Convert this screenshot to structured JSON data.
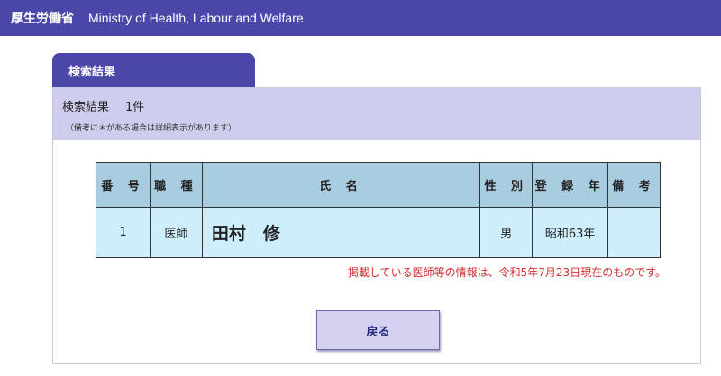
{
  "header": {
    "ministry_jp": "厚生労働省",
    "ministry_en": "Ministry of Health, Labour and Welfare"
  },
  "tab": {
    "label": "検索結果"
  },
  "summary": {
    "label": "検索結果",
    "count": "1件",
    "note": "（備考に＊がある場合は詳細表示があります）"
  },
  "table": {
    "headers": {
      "no": "番 号",
      "job": "職 種",
      "name": "氏 名",
      "sex": "性 別",
      "year": "登 録 年",
      "remarks": "備 考"
    },
    "rows": [
      {
        "no": "1",
        "job": "医師",
        "name": "田村　修",
        "sex": "男",
        "year": "昭和63年",
        "remarks": ""
      }
    ]
  },
  "info": "掲載している医師等の情報は、令和5年7月23日現在のものです。",
  "buttons": {
    "back": "戻る"
  },
  "colors": {
    "header_bg": "#4a47a8",
    "panel_head_bg": "#cfcdee",
    "table_header_bg": "#a8cce0",
    "table_cell_bg": "#cdeefa",
    "info_text": "#d03030",
    "button_bg": "#d4d2f0"
  }
}
